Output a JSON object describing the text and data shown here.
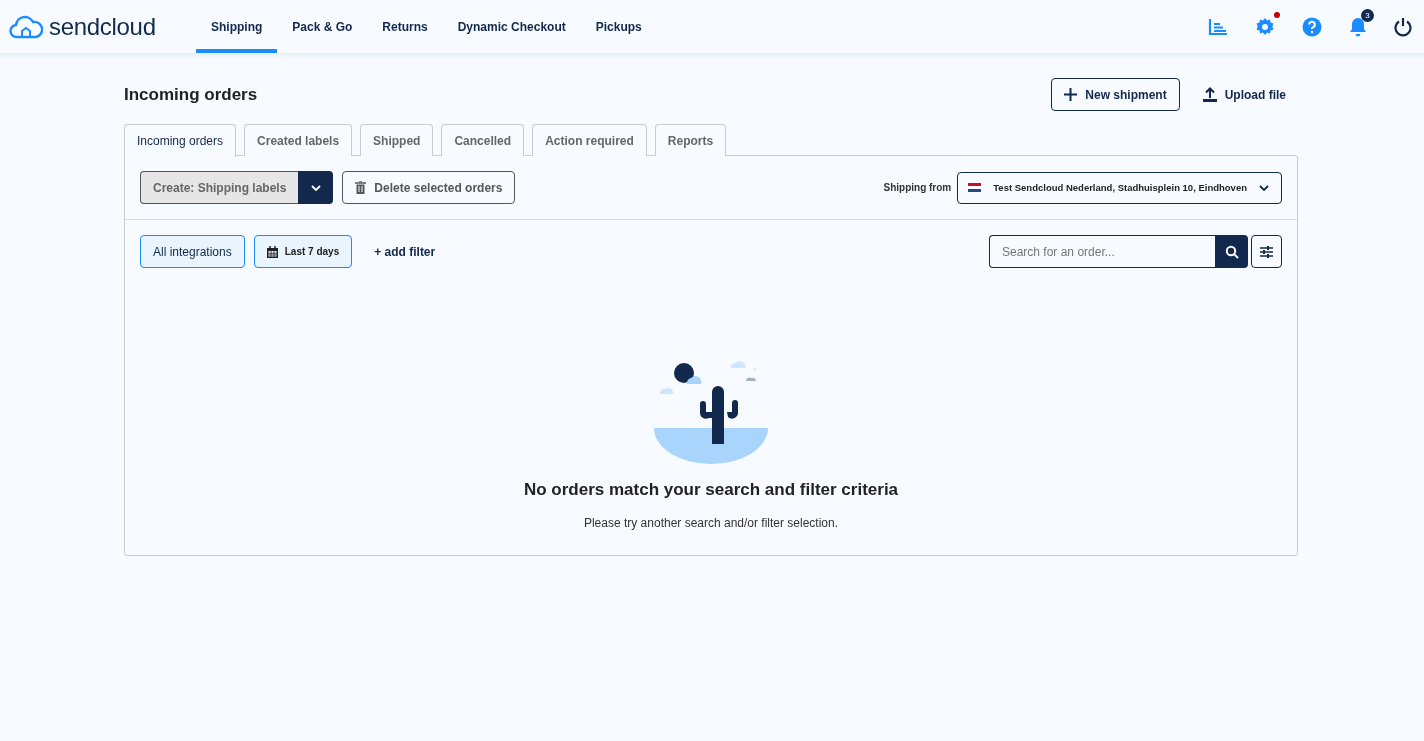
{
  "brand": {
    "name": "sendcloud"
  },
  "nav": [
    {
      "label": "Shipping",
      "selected": true
    },
    {
      "label": "Pack & Go",
      "selected": false
    },
    {
      "label": "Returns",
      "selected": false
    },
    {
      "label": "Dynamic Checkout",
      "selected": false
    },
    {
      "label": "Pickups",
      "selected": false
    }
  ],
  "header_icons": [
    {
      "kind": "analytics",
      "dot": false
    },
    {
      "kind": "settings",
      "dot": true
    },
    {
      "kind": "help",
      "dot": false
    },
    {
      "kind": "notifications",
      "dot": false,
      "badge": "3"
    },
    {
      "kind": "power",
      "dot": false
    }
  ],
  "page_title": "Incoming orders",
  "actions": [
    {
      "kind": "new",
      "label": "New shipment"
    },
    {
      "kind": "upload",
      "label": "Upload file"
    }
  ],
  "tabs": [
    {
      "label": "Incoming orders",
      "selected": true
    },
    {
      "label": "Created labels",
      "selected": false
    },
    {
      "label": "Shipped",
      "selected": false
    },
    {
      "label": "Cancelled",
      "selected": false
    },
    {
      "label": "Action required",
      "selected": false
    },
    {
      "label": "Reports",
      "selected": false
    }
  ],
  "toolbar": {
    "create_button": "Create: Shipping labels",
    "delete_button": "Delete selected orders",
    "shipping_from_label": "Shipping from",
    "shipping_from_value": "Test Sendcloud Nederland, Stadhuisplein 10, Eindhoven"
  },
  "filters": [
    {
      "kind": "chip",
      "label": "All integrations"
    },
    {
      "kind": "date",
      "label": "Last 7 days"
    },
    {
      "kind": "add",
      "label": "+ add filter"
    }
  ],
  "search": {
    "placeholder": "Search for an order..."
  },
  "empty_state": {
    "title": "No orders match your search and filter criteria",
    "message": "Please try another search and/or filter selection."
  }
}
